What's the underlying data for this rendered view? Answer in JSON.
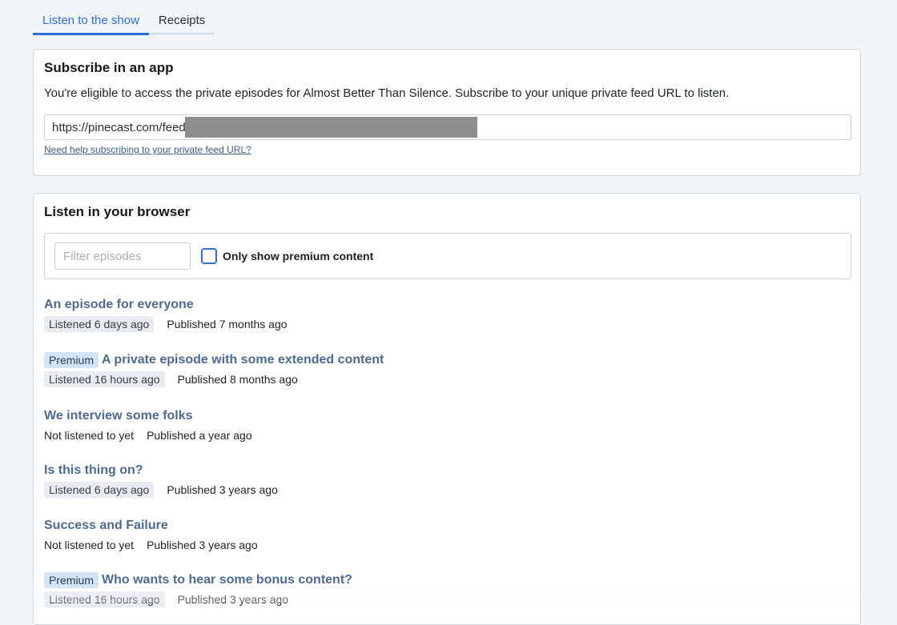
{
  "tabs": [
    {
      "label": "Listen to the show",
      "active": true
    },
    {
      "label": "Receipts",
      "active": false
    }
  ],
  "subscribe": {
    "title": "Subscribe in an app",
    "description": "You're eligible to access the private episodes for Almost Better Than Silence. Subscribe to your unique private feed URL to listen.",
    "feed_url_visible": "https://pinecast.com/feed",
    "help_link": "Need help subscribing to your private feed URL?"
  },
  "browser": {
    "title": "Listen in your browser",
    "filter_placeholder": "Filter episodes",
    "premium_only_label": "Only show premium content",
    "premium_only_checked": false
  },
  "episodes": [
    {
      "title": "An episode for everyone",
      "premium": false,
      "listened": "Listened 6 days ago",
      "published": "Published 7 months ago"
    },
    {
      "title": "A private episode with some extended content",
      "premium": true,
      "listened": "Listened 16 hours ago",
      "published": "Published 8 months ago"
    },
    {
      "title": "We interview some folks",
      "premium": false,
      "listened": null,
      "not_listened": "Not listened to yet",
      "published": "Published a year ago"
    },
    {
      "title": "Is this thing on?",
      "premium": false,
      "listened": "Listened 6 days ago",
      "published": "Published 3 years ago"
    },
    {
      "title": "Success and Failure",
      "premium": false,
      "listened": null,
      "not_listened": "Not listened to yet",
      "published": "Published 3 years ago"
    },
    {
      "title": "Who wants to hear some bonus content?",
      "premium": true,
      "listened": "Listened 16 hours ago",
      "published": "Published 3 years ago"
    }
  ],
  "premium_badge_label": "Premium",
  "colors": {
    "accent": "#2b6fd6",
    "episode_title": "#4d6a91",
    "premium_badge_bg": "#d4e3f7",
    "listened_badge_bg": "#e9edf1",
    "background": "#f3f6f9"
  }
}
